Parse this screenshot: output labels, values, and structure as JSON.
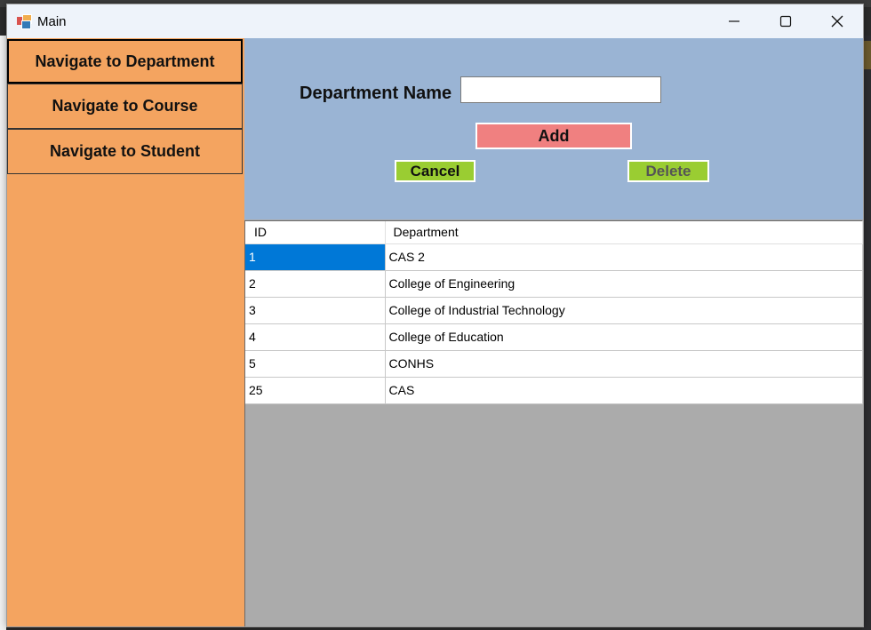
{
  "window": {
    "title": "Main"
  },
  "sidebar": {
    "items": [
      {
        "label": "Navigate to Department"
      },
      {
        "label": "Navigate to Course"
      },
      {
        "label": "Navigate to Student"
      }
    ]
  },
  "form": {
    "department_label": "Department Name",
    "department_value": "",
    "add_label": "Add",
    "cancel_label": "Cancel",
    "delete_label": "Delete"
  },
  "grid": {
    "columns": [
      "ID",
      "Department"
    ],
    "rows": [
      {
        "id": "1",
        "department": "CAS 2",
        "selected": true
      },
      {
        "id": "2",
        "department": "College of Engineering"
      },
      {
        "id": "3",
        "department": "College of Industrial Technology"
      },
      {
        "id": "4",
        "department": "College of Education"
      },
      {
        "id": "5",
        "department": "CONHS"
      },
      {
        "id": "25",
        "department": "CAS"
      }
    ]
  },
  "colors": {
    "sidebar": "#f4a460",
    "form_panel": "#9ab4d4",
    "add_button": "#f08080",
    "action_buttons": "#9acd32",
    "grid_background": "#ababab",
    "selection": "#0078d7"
  },
  "icons": {
    "app": "app-form-icon",
    "minimize": "minimize-icon",
    "maximize": "maximize-icon",
    "close": "close-icon"
  }
}
